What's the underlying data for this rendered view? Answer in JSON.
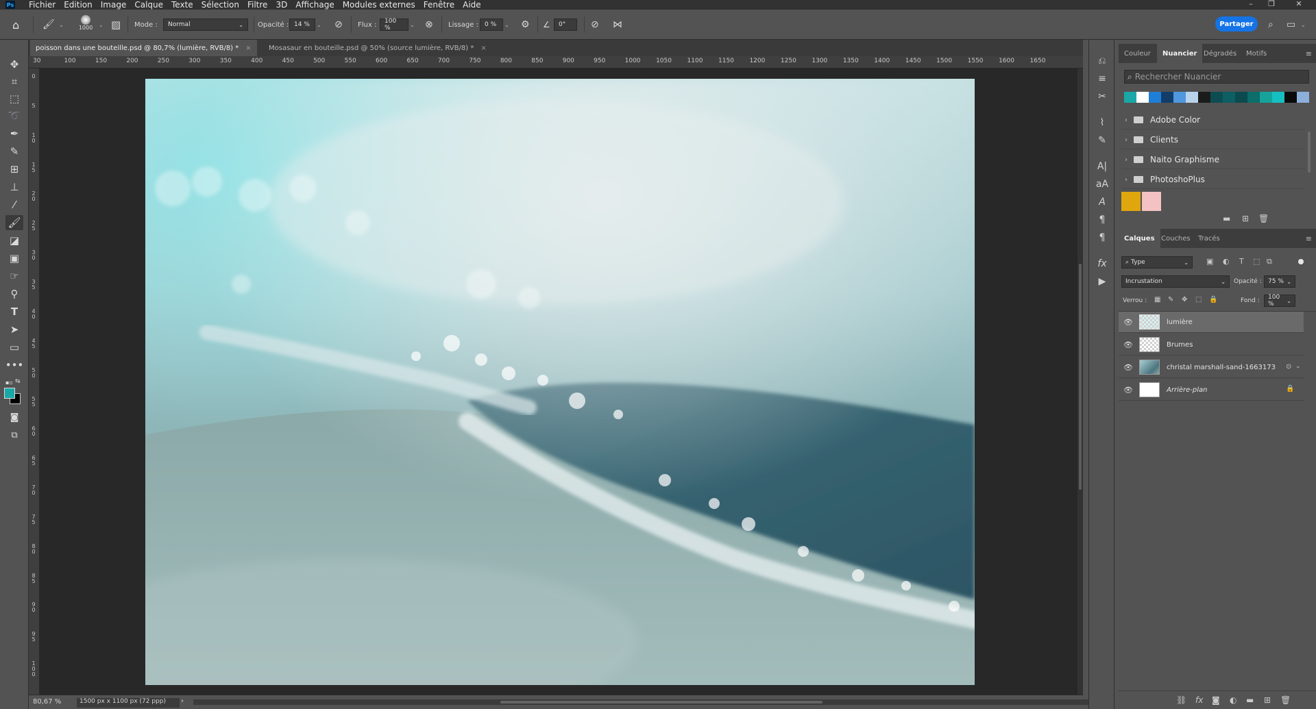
{
  "menubar": {
    "app_icon": "Ps",
    "items": [
      "Fichier",
      "Edition",
      "Image",
      "Calque",
      "Texte",
      "Sélection",
      "Filtre",
      "3D",
      "Affichage",
      "Modules externes",
      "Fenêtre",
      "Aide"
    ],
    "window_controls": [
      "–",
      "❐",
      "✕"
    ]
  },
  "options": {
    "brush_size": "1000",
    "mode_label": "Mode :",
    "mode_value": "Normal",
    "opacity_label": "Opacité :",
    "opacity_value": "14 %",
    "flow_label": "Flux :",
    "flow_value": "100 %",
    "smoothing_label": "Lissage :",
    "smoothing_value": "0 %",
    "angle_value": "0°",
    "share_label": "Partager"
  },
  "tabs": [
    {
      "label": "poisson dans une bouteille.psd @ 80,7% (lumière, RVB/8) *",
      "close": "×"
    },
    {
      "label": "Mosasaur en bouteille.psd @ 50% (source lumière, RVB/8) *",
      "close": "×"
    }
  ],
  "ruler": {
    "top_labels": [
      "30",
      "100",
      "150",
      "200",
      "250",
      "300",
      "350",
      "400",
      "450",
      "500",
      "550",
      "600",
      "650",
      "700",
      "750",
      "800",
      "850",
      "900",
      "950",
      "1000",
      "1050",
      "1100",
      "1150",
      "1200",
      "1250",
      "1300",
      "1350",
      "1400",
      "1450",
      "1500",
      "1550",
      "1600",
      "1650"
    ],
    "left_labels": [
      "0",
      "5",
      "1 0",
      "1 5",
      "2 0",
      "2 5",
      "3 0",
      "3 5",
      "4 0",
      "4 5",
      "5 0",
      "5 5",
      "6 0",
      "6 5",
      "7 0",
      "7 5",
      "8 0",
      "8 5",
      "9 0",
      "9 5",
      "1 0 0"
    ]
  },
  "status": {
    "zoom": "80,67 %",
    "doc_info": "1500 px x 1100 px (72 ppp)"
  },
  "swatches_panel": {
    "tabs": [
      "Couleur",
      "Nuancier",
      "Dégradés",
      "Motifs"
    ],
    "active_tab": "Nuancier",
    "search_placeholder": "Rechercher Nuancier",
    "recent_colors": [
      "#1aa7a7",
      "#ffffff",
      "#1f7fd6",
      "#123d6b",
      "#4f98e0",
      "#b8d3ea",
      "#1b1b1b",
      "#0d4d52",
      "#0d5f63",
      "#0b4a4e",
      "#0c6d6b",
      "#15a39c",
      "#16c0c0",
      "#0a0a0a",
      "#8db0db"
    ],
    "groups": [
      "Adobe Color",
      "Clients",
      "Naito Graphisme",
      "PhotoshoPlus"
    ],
    "loose_colors": [
      "#e0a60d",
      "#f4c2c2"
    ]
  },
  "layers_panel": {
    "tabs": [
      "Calques",
      "Couches",
      "Tracés"
    ],
    "active_tab": "Calques",
    "filter_label": "Type",
    "blend_mode": "Incrustation",
    "opacity_label": "Opacité :",
    "opacity_value": "75 %",
    "lock_label": "Verrou :",
    "fill_label": "Fond :",
    "fill_value": "100 %",
    "layers": [
      {
        "name": "lumière",
        "selected": true
      },
      {
        "name": "Brumes",
        "selected": false
      },
      {
        "name": "christal marshall-sand-1663173",
        "selected": false
      },
      {
        "name": "Arrière-plan",
        "selected": false
      }
    ]
  },
  "colors": {
    "foreground": "#1aa7a7",
    "background": "#000000",
    "accent": "#1473e6"
  }
}
